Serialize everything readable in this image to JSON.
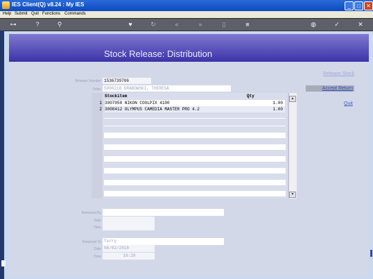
{
  "window": {
    "title": "IES Client(Q) v8.24 : My IES",
    "minimize": "_",
    "maximize": "□",
    "close": "✕"
  },
  "menu": [
    "Help",
    "Submit",
    "Quit",
    "Functions",
    "Commands"
  ],
  "toolbar": {
    "icons": [
      "key-icon",
      "help-icon",
      "search-icon",
      "heart-icon",
      "refresh-icon",
      "rewind-icon",
      "fast-forward-icon",
      "document-icon",
      "stop-icon",
      "globe-icon",
      "check-icon",
      "close-icon"
    ]
  },
  "header": {
    "title": "Stock Release: Distribution"
  },
  "form": {
    "release_number_label": "Release Number",
    "release_number": "1536739706",
    "order_label": "Order",
    "order": "S000218 GRABOWSKI, THERESA"
  },
  "grid": {
    "columns": [
      "Stockitem",
      "Qty"
    ],
    "rows": [
      {
        "num": "1",
        "item": "3007058 NIKON COOLPIX 4100",
        "qty": "1.00"
      },
      {
        "num": "2",
        "item": "3008412 OLYMPUS CAMEDIA MASTER PRO 4.2",
        "qty": "1.00"
      }
    ]
  },
  "actions": {
    "release_stock": "Release Stock",
    "accept_return": "Accept Return",
    "quit": "Quit"
  },
  "release_info": {
    "released_by_label": "Released By",
    "released_by": "",
    "date_label": "Date",
    "date": "",
    "time_label": "Time",
    "time": ""
  },
  "return_info": {
    "returned_to_label": "Returned To",
    "returned_to": "Terry",
    "date_label": "Date",
    "date": "06/02/2018",
    "time_label": "Time",
    "time": "16:28"
  },
  "colors": {
    "header_top": "#8078d0",
    "header_bottom": "#3c34a8",
    "panel": "#d3d8e9",
    "link": "#3a5fc0"
  }
}
